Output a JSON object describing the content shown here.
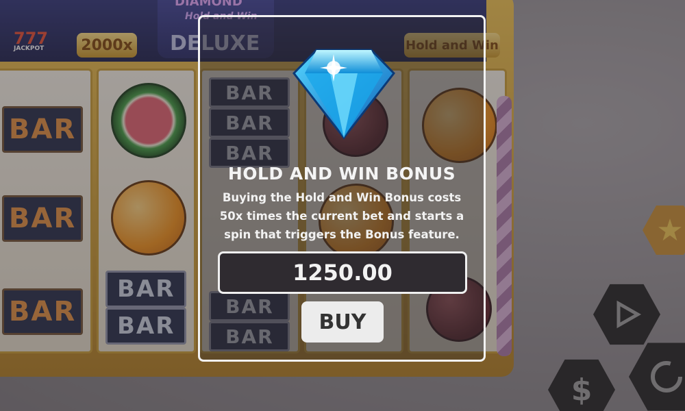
{
  "game": {
    "logo_subtitle": "Hold and Win",
    "logo_brand": "DIAMOND",
    "logo_word": "DELUXE",
    "paytable_left": "2000x",
    "paytable_right": "Hold and Win",
    "jackpot_label": "JACKPOT",
    "symbol_bar": "BAR"
  },
  "dialog": {
    "title": "HOLD AND WIN BONUS",
    "body": "Buying the Hold and Win Bonus costs 50x times the current bet and starts a spin that triggers the Bonus feature.",
    "price": "1250.00",
    "buy_label": "BUY"
  },
  "controls": {
    "dollar_glyph": "$"
  },
  "icons": [
    "diamond-icon",
    "star-icon",
    "play-icon",
    "dollar-icon",
    "autospin-icon"
  ]
}
